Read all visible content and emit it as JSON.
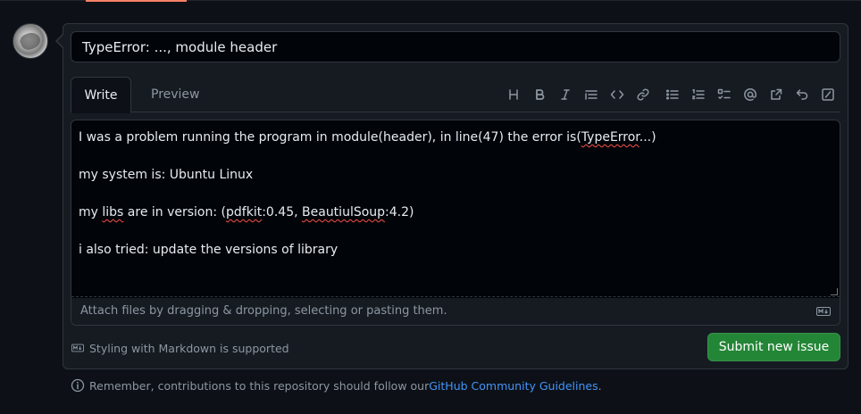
{
  "issue": {
    "title_value": "TypeError: ..., module header"
  },
  "editor": {
    "tabs": [
      "Write",
      "Preview"
    ],
    "active_tab": "Write",
    "toolbar_icons": [
      "heading-icon",
      "bold-icon",
      "italic-icon",
      "quote-icon",
      "code-icon",
      "link-icon",
      "unordered-list-icon",
      "ordered-list-icon",
      "task-list-icon",
      "mention-icon",
      "reference-icon",
      "undo-icon",
      "slash-commands-icon"
    ],
    "body_lines": [
      "I was a problem running the program in module(header), in line(47) the error is(TypeError...)",
      "",
      "my system is: Ubuntu Linux",
      "",
      "my libs are in version: (pdfkit:0.45, BeautiulSoup:4.2)",
      "",
      "i also tried: update the versions of library"
    ],
    "attach_text": "Attach files by dragging & dropping, selecting or pasting them."
  },
  "footer": {
    "markdown_note": "Styling with Markdown is supported",
    "submit_label": "Submit new issue",
    "reminder_prefix": "Remember, contributions to this repository should follow our ",
    "reminder_link": "GitHub Community Guidelines",
    "reminder_suffix": "."
  },
  "colors": {
    "background": "#0d1117",
    "panel": "#161b22",
    "border": "#30363d",
    "submit": "#238636",
    "link": "#4493f8",
    "accent": "#f78166"
  }
}
